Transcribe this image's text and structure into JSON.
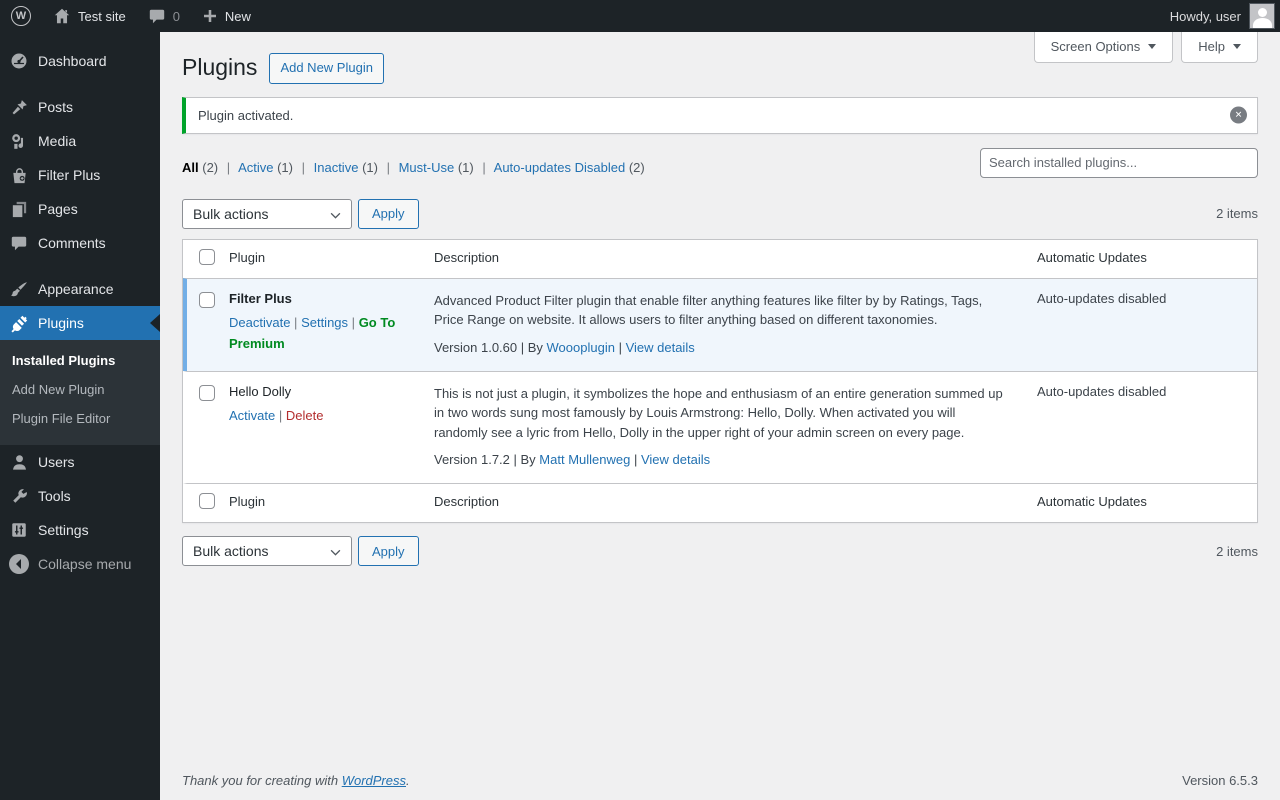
{
  "icons": {
    "wordpress_glyph": "W",
    "dismiss_glyph": "✕"
  },
  "admin_bar": {
    "site_name": "Test site",
    "comment_count": "0",
    "new_label": "New",
    "howdy": "Howdy, user"
  },
  "sidebar": {
    "dashboard": "Dashboard",
    "posts": "Posts",
    "media": "Media",
    "filter_plus": "Filter Plus",
    "pages": "Pages",
    "comments": "Comments",
    "appearance": "Appearance",
    "plugins": "Plugins",
    "installed_plugins": "Installed Plugins",
    "add_new_plugin": "Add New Plugin",
    "plugin_file_editor": "Plugin File Editor",
    "users": "Users",
    "tools": "Tools",
    "settings": "Settings",
    "collapse_menu": "Collapse menu"
  },
  "header": {
    "title": "Plugins",
    "add_new_button": "Add New Plugin",
    "screen_options": "Screen Options",
    "help": "Help"
  },
  "notice": {
    "message": "Plugin activated."
  },
  "filters": {
    "all": "All",
    "all_count": "(2)",
    "active": "Active",
    "active_count": "(1)",
    "inactive": "Inactive",
    "inactive_count": "(1)",
    "must_use": "Must-Use",
    "must_use_count": "(1)",
    "auto_disabled": "Auto-updates Disabled",
    "auto_disabled_count": "(2)",
    "separator": "|"
  },
  "toolbar": {
    "bulk_actions": "Bulk actions",
    "apply": "Apply",
    "items_count": "2 items",
    "search_placeholder": "Search installed plugins..."
  },
  "table": {
    "headers": {
      "plugin": "Plugin",
      "description": "Description",
      "auto_updates": "Automatic Updates"
    },
    "separator": "|",
    "rows": [
      {
        "name": "Filter Plus",
        "action_deactivate": "Deactivate",
        "action_settings": "Settings",
        "action_premium": "Go To Premium",
        "description": "Advanced Product Filter plugin that enable filter anything features like filter by by Ratings, Tags, Price Range on website. It allows users to filter anything based on different taxonomies.",
        "version_by": "Version 1.0.60 | By",
        "author": "Woooplugin",
        "view_details": "View details",
        "auto_updates": "Auto-updates disabled"
      },
      {
        "name": "Hello Dolly",
        "action_activate": "Activate",
        "action_delete": "Delete",
        "description": "This is not just a plugin, it symbolizes the hope and enthusiasm of an entire generation summed up in two words sung most famously by Louis Armstrong: Hello, Dolly. When activated you will randomly see a lyric from Hello, Dolly in the upper right of your admin screen on every page.",
        "version_by": "Version 1.7.2 | By",
        "author": "Matt Mullenweg",
        "view_details": "View details",
        "auto_updates": "Auto-updates disabled"
      }
    ]
  },
  "footer": {
    "thanks": "Thank you for creating with",
    "wordpress": "WordPress",
    "period": ".",
    "version": "Version 6.5.3"
  }
}
